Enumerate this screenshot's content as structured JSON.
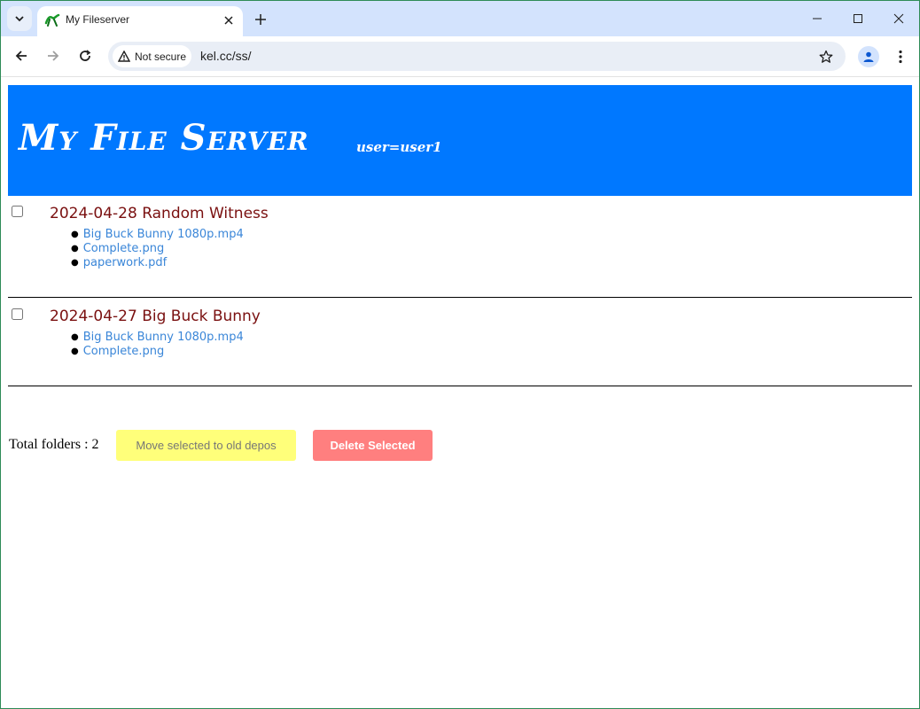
{
  "browser": {
    "tab_title": "My Fileserver",
    "security_label": "Not secure",
    "url": "kel.cc/ss/"
  },
  "page": {
    "site_title": "My File Server",
    "user_label": "user=user1",
    "folders": [
      {
        "title": "2024-04-28 Random Witness",
        "files": [
          "Big Buck Bunny 1080p.mp4",
          "Complete.png",
          "paperwork.pdf"
        ]
      },
      {
        "title": "2024-04-27 Big Buck Bunny",
        "files": [
          "Big Buck Bunny 1080p.mp4",
          "Complete.png"
        ]
      }
    ],
    "total_folders": "Total folders : 2",
    "move_button": "Move selected to old depos",
    "delete_button": "Delete Selected"
  },
  "colors": {
    "banner": "#0078ff",
    "folder_title": "#7a1010",
    "link": "#3a86d8",
    "move_button_bg": "#ffff7a",
    "delete_button_bg": "#ff7f7f"
  },
  "icons": [
    "tab-search-icon",
    "favicon-icon",
    "tab-close-icon",
    "new-tab-icon",
    "minimize-icon",
    "maximize-icon",
    "window-close-icon",
    "back-icon",
    "forward-icon",
    "reload-icon",
    "warning-icon",
    "star-icon",
    "profile-icon",
    "menu-icon"
  ]
}
